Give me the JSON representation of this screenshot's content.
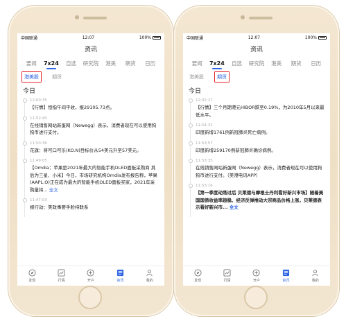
{
  "left": {
    "status": {
      "carrier": "中国联通",
      "time": "12:07",
      "battery": "100%"
    },
    "title": "资讯",
    "tabs": [
      "要闻",
      "7x24",
      "自选",
      "研究院",
      "港美",
      "期货",
      "日历"
    ],
    "active_tab": "7x24",
    "subtabs": [
      "港美股",
      "期货"
    ],
    "active_subtab": "港美股",
    "day": "今日",
    "items": [
      {
        "time": "12:00:35",
        "text": "【行情】恒指午间平收，报29105.73点。"
      },
      {
        "time": "11:52:40",
        "text": "在线销售网站新蛋网（Newegg）表示，消费者现在可以使用狗狗币进行支付。"
      },
      {
        "time": "11:50:36",
        "text": "花旗：将可口可乐(KO.N)目标价从54美元升至57美元。"
      },
      {
        "time": "11:49:05",
        "text": "【Omdia：苹果是2021年最大的智能手机OLED面板采购商 其后为三星、小米】今日，市场研究机构Omdia发布报告称，苹果(AAPL.O)正在成为最大的智能手机OLED面板买家，2021年采购量将...",
        "link": "全文"
      },
      {
        "time": "11:47:03",
        "text": "报行动：美政事要手脸持联系"
      }
    ],
    "nav": [
      "发现",
      "行情",
      "开户",
      "资讯",
      "我的"
    ]
  },
  "right": {
    "status": {
      "carrier": "中国联通",
      "time": "12:07",
      "battery": "100%"
    },
    "title": "资讯",
    "tabs": [
      "要闻",
      "7x24",
      "自选",
      "研究院",
      "港美",
      "期货",
      "日历"
    ],
    "active_tab": "7x24",
    "subtabs": [
      "港美股",
      "期货"
    ],
    "active_subtab": "期货",
    "day": "今日",
    "items": [
      {
        "time": "12:02:27",
        "text": "【行情】三个月期港元HIBOR跌至0.19%，为2010年5月以来最低水平。"
      },
      {
        "time": "11:54:32",
        "text": "印度新增1761例新冠肺炎死亡病例。"
      },
      {
        "time": "11:53:57",
        "text": "印度新增259170例新冠肺炎确诊病例。"
      },
      {
        "time": "11:53:35",
        "text": "在线销售网站新蛋网（Newegg）表示，消费者现在可以使用狗狗币进行支付。（美港电讯APP）"
      },
      {
        "time": "11:53:16",
        "text": "【第一季度动荡过后 贝莱德与摩根士丹利看好新兴市场】随着美国国债收益率趋稳、经济反弹推动大宗商品价格上涨，贝莱德表示看好新兴市...",
        "link": "全文",
        "bold": true
      }
    ],
    "nav": [
      "发现",
      "行情",
      "开户",
      "资讯",
      "我的"
    ]
  },
  "colors": {
    "accent": "#2f64e4",
    "highlight_box": "#e5262b",
    "phone_frame": "#f1e2c8"
  }
}
